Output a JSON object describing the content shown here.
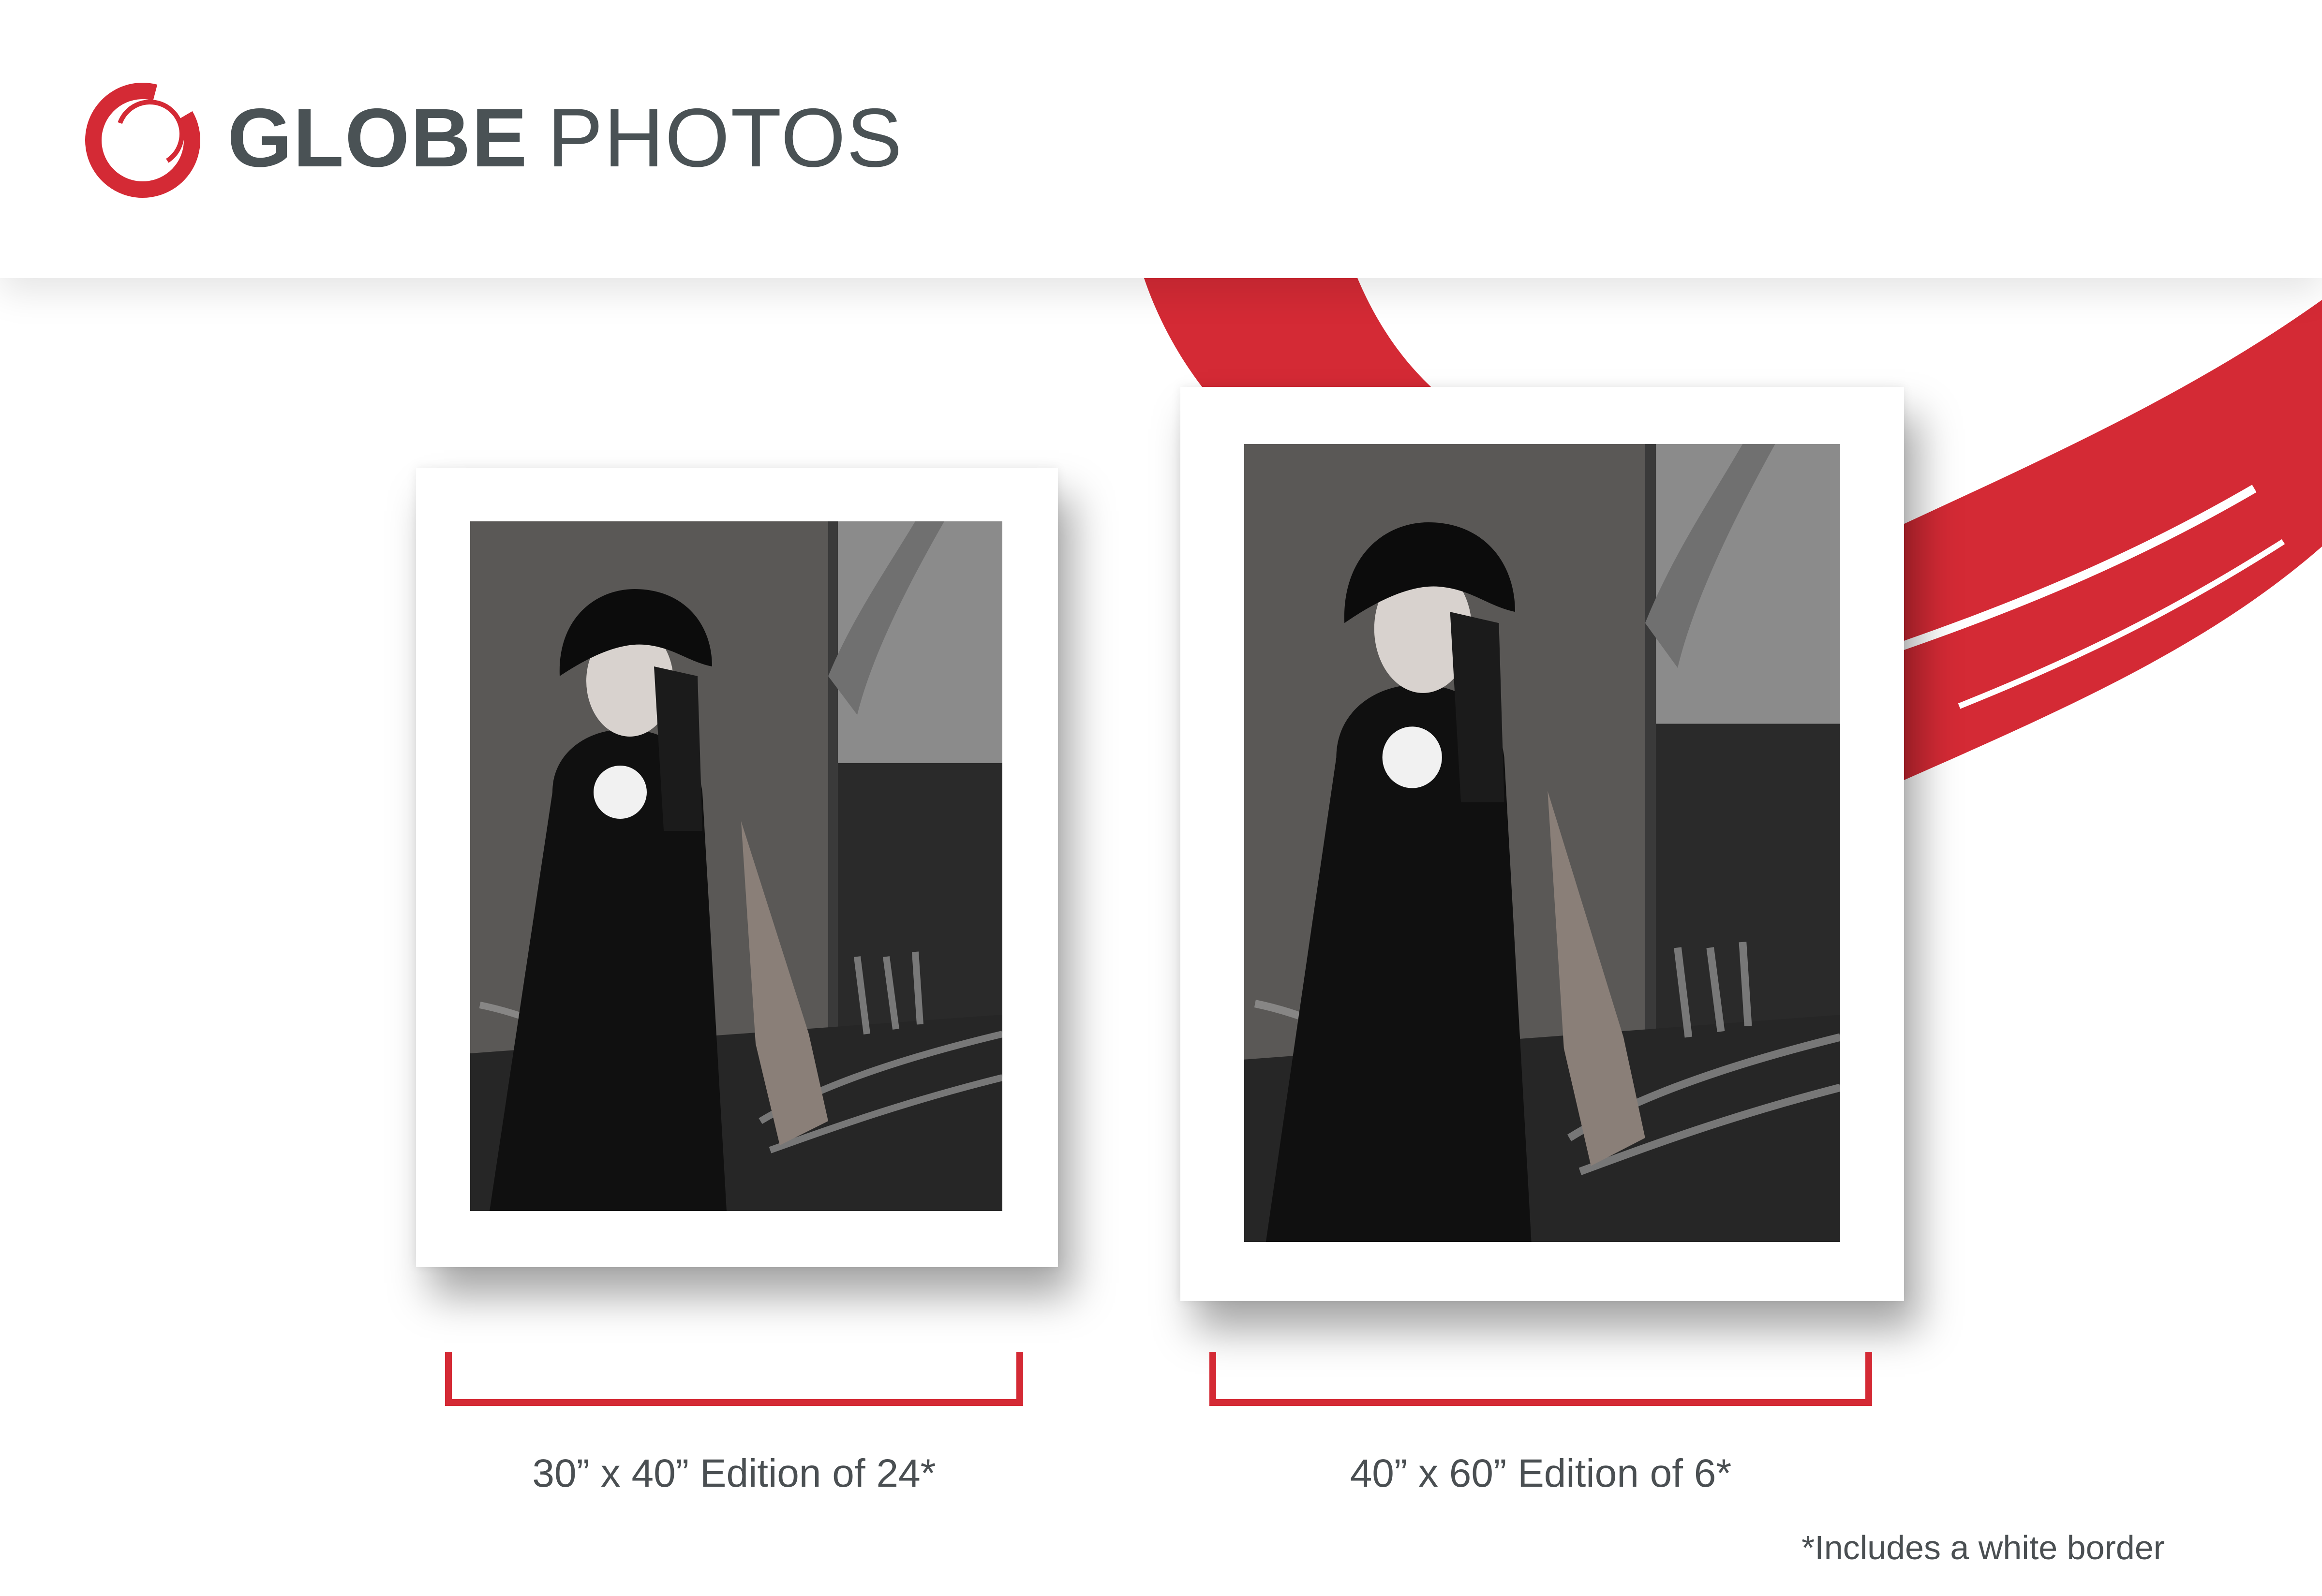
{
  "brand": {
    "name_bold": "GLOBE",
    "name_light": "PHOTOS",
    "logo_icon": "brush-ring-logo",
    "accent_color": "#d42a35",
    "text_color": "#4a5255"
  },
  "prints": [
    {
      "caption": "30” x 40” Edition of 24*",
      "photo": "black-and-white portrait of woman in cloche hat and black coat seated by tree trunk"
    },
    {
      "caption": "40” x 60” Edition of 6*",
      "photo": "black-and-white portrait of woman in cloche hat and black coat seated by tree trunk"
    }
  ],
  "footnote": "*Includes a white border"
}
